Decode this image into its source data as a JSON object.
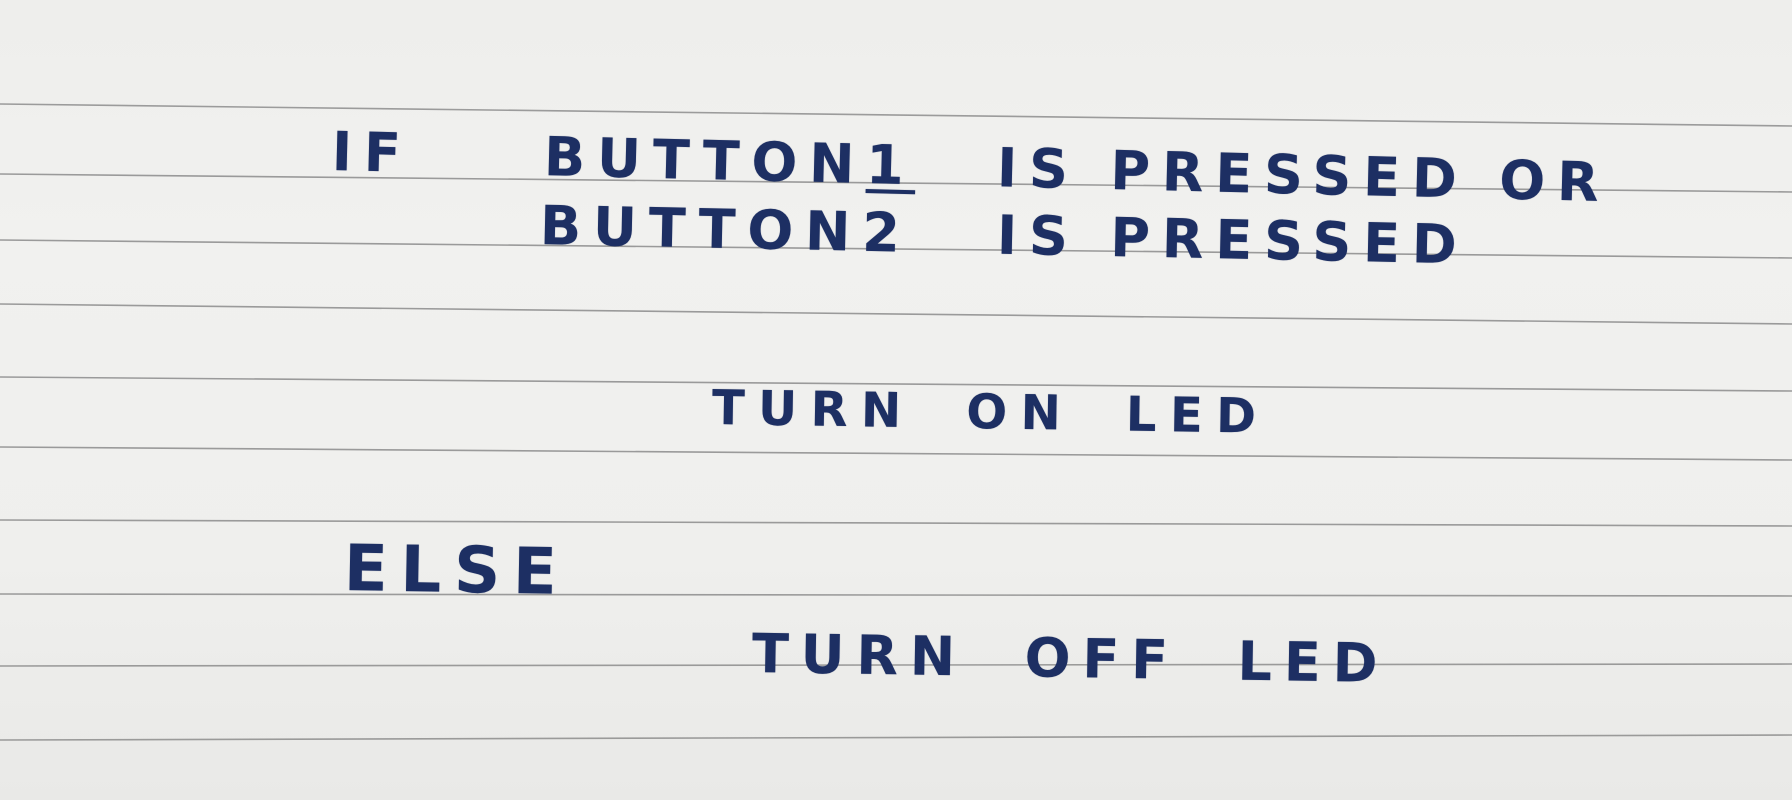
{
  "note": {
    "line1": {
      "if_word": "IF",
      "button_word": "BUTTON",
      "button_number": "1",
      "is_pressed": "IS PRESSED OR"
    },
    "line2": {
      "button_word": "BUTTON",
      "button_number": "2",
      "is_pressed": "IS PRESSED"
    },
    "line3": "TURN ON LED",
    "line4": "ELSE",
    "line5": "TURN OFF LED"
  },
  "colors": {
    "ink": "#1d2f63",
    "paper": "#efefed",
    "rule_line": "#8c8c8c"
  }
}
